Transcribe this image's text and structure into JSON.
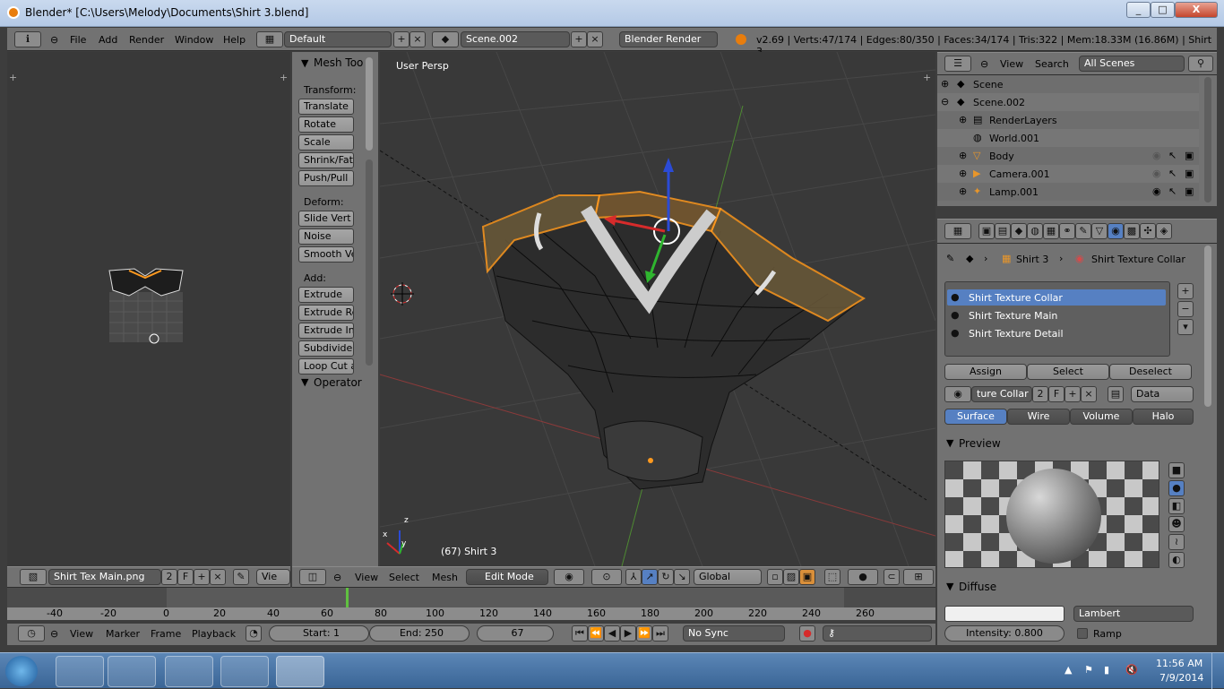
{
  "window": {
    "title": "Blender* [C:\\Users\\Melody\\Documents\\Shirt 3.blend]",
    "min": "_",
    "max": "□",
    "close": "X"
  },
  "menu": [
    "File",
    "Add",
    "Render",
    "Window",
    "Help"
  ],
  "layout": "Default",
  "scene": "Scene.002",
  "engine": "Blender Render",
  "stats": "v2.69 | Verts:47/174 | Edges:80/350 | Faces:34/174 | Tris:322 | Mem:18.33M (16.86M) | Shirt 3",
  "tool": {
    "header": "Mesh Too",
    "transform_label": "Transform:",
    "transform": [
      "Translate",
      "Rotate",
      "Scale",
      "Shrink/Fatt",
      "Push/Pull"
    ],
    "deform_label": "Deform:",
    "deform": [
      "Slide Vert",
      "Noise",
      "Smooth Ve"
    ],
    "add_label": "Add:",
    "add": [
      "Extrude",
      "Extrude Re",
      "Extrude Ind",
      "Subdivide",
      "Loop Cut a"
    ],
    "operator": "Operator"
  },
  "viewport": {
    "label": "User Persp",
    "object_info": "(67) Shirt 3",
    "axis_x": "x",
    "axis_y": "y",
    "axis_z": "z"
  },
  "image_editor": {
    "image": "Shirt Tex Main.png",
    "users": "2",
    "fake": "F",
    "view": "Vie"
  },
  "view3d_header": {
    "view": "View",
    "select": "Select",
    "mesh": "Mesh",
    "mode": "Edit Mode",
    "orientation": "Global"
  },
  "outliner": {
    "view": "View",
    "search": "Search",
    "filter": "All Scenes",
    "items": [
      {
        "label": "Scene"
      },
      {
        "label": "Scene.002"
      },
      {
        "label": "RenderLayers"
      },
      {
        "label": "World.001"
      },
      {
        "label": "Body"
      },
      {
        "label": "Camera.001"
      },
      {
        "label": "Lamp.001"
      }
    ]
  },
  "props": {
    "object": "Shirt 3",
    "material": "Shirt Texture Collar",
    "slots": [
      "Shirt Texture Collar",
      "Shirt Texture Main",
      "Shirt Texture Detail"
    ],
    "assign": "Assign",
    "select": "Select",
    "deselect": "Deselect",
    "mat_field": "ture Collar",
    "users": "2",
    "fake": "F",
    "data": "Data",
    "tabs": [
      "Surface",
      "Wire",
      "Volume",
      "Halo"
    ],
    "preview": "Preview",
    "diffuse": "Diffuse",
    "shader": "Lambert",
    "intensity": "Intensity: 0.800",
    "ramp": "Ramp"
  },
  "timeline": {
    "ticks": [
      "-40",
      "-20",
      "0",
      "20",
      "40",
      "60",
      "80",
      "100",
      "120",
      "140",
      "160",
      "180",
      "200",
      "220",
      "240",
      "260"
    ],
    "view": "View",
    "marker": "Marker",
    "frame": "Frame",
    "playback": "Playback",
    "start": "Start: 1",
    "end": "End: 250",
    "current": "67",
    "sync": "No Sync"
  },
  "tray": {
    "time": "11:56 AM",
    "date": "7/9/2014"
  }
}
